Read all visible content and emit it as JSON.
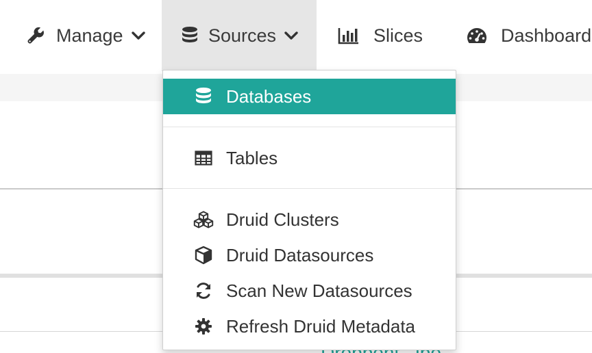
{
  "navbar": {
    "manage": {
      "label": "Manage",
      "icon": "wrench-icon"
    },
    "sources": {
      "label": "Sources",
      "icon": "database-icon"
    },
    "slices": {
      "label": "Slices",
      "icon": "bar-chart-icon"
    },
    "dashboards": {
      "label": "Dashboard",
      "icon": "dashboard-icon"
    }
  },
  "dropdown": {
    "items": [
      {
        "label": "Databases",
        "icon": "database-icon",
        "selected": true
      },
      {
        "label": "Tables",
        "icon": "table-icon"
      },
      {
        "label": "Druid Clusters",
        "icon": "cubes-icon"
      },
      {
        "label": "Druid Datasources",
        "icon": "cube-icon"
      },
      {
        "label": "Scan New Datasources",
        "icon": "refresh-icon"
      },
      {
        "label": "Refresh Druid Metadata",
        "icon": "gear-icon"
      }
    ]
  },
  "background": {
    "partial_link": "Dropbont_Jbo"
  },
  "colors": {
    "accent": "#1fa59a",
    "nav_active_bg": "#e6e6e6",
    "text": "#333333"
  }
}
